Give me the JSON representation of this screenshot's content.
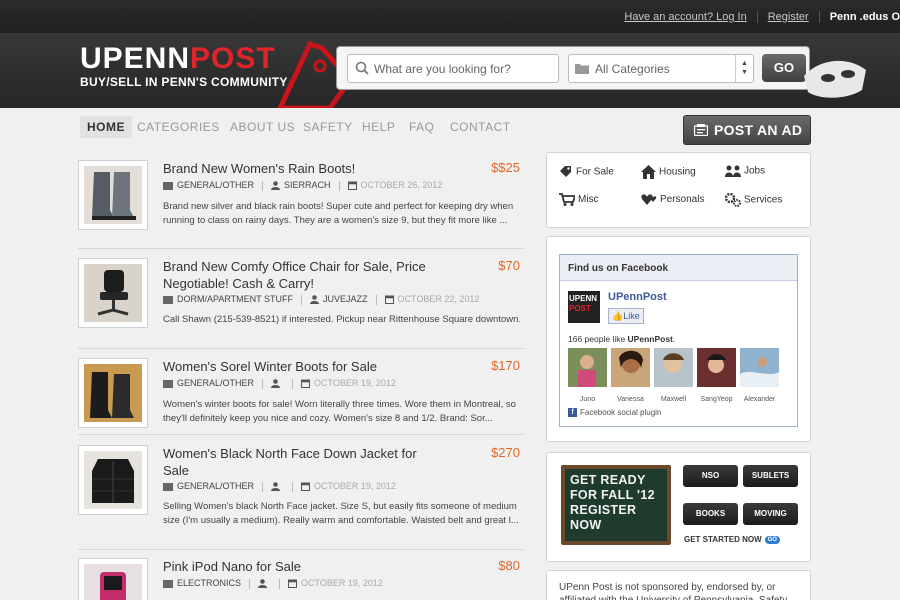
{
  "topbar": {
    "account_prompt": "Have an account? ",
    "login": "Log In",
    "register": "Register",
    "user": "Penn .edus O"
  },
  "logo": {
    "line1_a": "UPENN",
    "line1_b": "POST",
    "tagline": "BUY/SELL IN PENN'S COMMUNITY"
  },
  "search": {
    "placeholder": "What are you looking for?",
    "category": "All Categories",
    "go": "GO"
  },
  "nav": {
    "items": [
      "HOME",
      "CATEGORIES",
      "ABOUT US",
      "SAFETY",
      "HELP",
      "FAQ",
      "CONTACT"
    ],
    "post_ad": "POST AN AD"
  },
  "listings": [
    {
      "title": "Brand New Women's Rain Boots!",
      "price": "$$25",
      "category": "GENERAL/OTHER",
      "user": "SIERRACH",
      "date": "OCTOBER 26, 2012",
      "desc": "Brand new silver and black rain boots! Super cute and perfect for keeping dry when running to class on rainy days. They are a women's size 9, but they fit more like ..."
    },
    {
      "title": "Brand New Comfy Office Chair for Sale, Price Negotiable! Cash & Carry!",
      "price": "$70",
      "category": "DORM/APARTMENT STUFF",
      "user": "JUVEJAZZ",
      "date": "OCTOBER 22, 2012",
      "desc": "Call Shawn (215-539-8521) if interested. Pickup near Rittenhouse Square downtown."
    },
    {
      "title": "Women's Sorel Winter Boots for Sale",
      "price": "$170",
      "category": "GENERAL/OTHER",
      "user": "",
      "date": "OCTOBER 19, 2012",
      "desc": "Women's winter boots for sale! Worn literally three times. Wore them in Montreal, so they'll definitely keep you nice and cozy. Women's size 8 and 1/2. Brand: Sor..."
    },
    {
      "title": "Women's Black North Face Down Jacket for Sale",
      "price": "$270",
      "category": "GENERAL/OTHER",
      "user": "",
      "date": "OCTOBER 19, 2012",
      "desc": "Selling Women's black North Face jacket. Size S, but easily fits someone of medium size (I'm usually a medium). Really warm and comfortable. Waisted belt and great l..."
    },
    {
      "title": "Pink iPod Nano for Sale",
      "price": "$80",
      "category": "ELECTRONICS",
      "user": "",
      "date": "OCTOBER 19, 2012",
      "desc": ""
    }
  ],
  "categories": {
    "for_sale": "For Sale",
    "housing": "Housing",
    "jobs": "Jobs",
    "misc": "Misc",
    "personals": "Personals",
    "services": "Services"
  },
  "facebook": {
    "header": "Find us on Facebook",
    "page_name": "UPennPost",
    "like": "Like",
    "count_prefix": "166 people like ",
    "count_page": "UPennPost",
    "count_suffix": ".",
    "faces": [
      "Juno",
      "Vanessa",
      "Maxwell",
      "SangYeop",
      "Alexander"
    ],
    "plugin": "Facebook social plugin",
    "logo_l1": "UPENN",
    "logo_l2": "POST"
  },
  "promo": {
    "chalk": [
      "GET READY",
      "FOR FALL '12",
      "REGISTER",
      "NOW"
    ],
    "buttons": [
      "NSO",
      "SUBLETS",
      "BOOKS",
      "MOVING"
    ],
    "get_started": "GET STARTED NOW",
    "go": "GO"
  },
  "disclaimer": "UPenn Post is not sponsored by, endorsed by, or affiliated with the University of Pennsylvania. Safety"
}
